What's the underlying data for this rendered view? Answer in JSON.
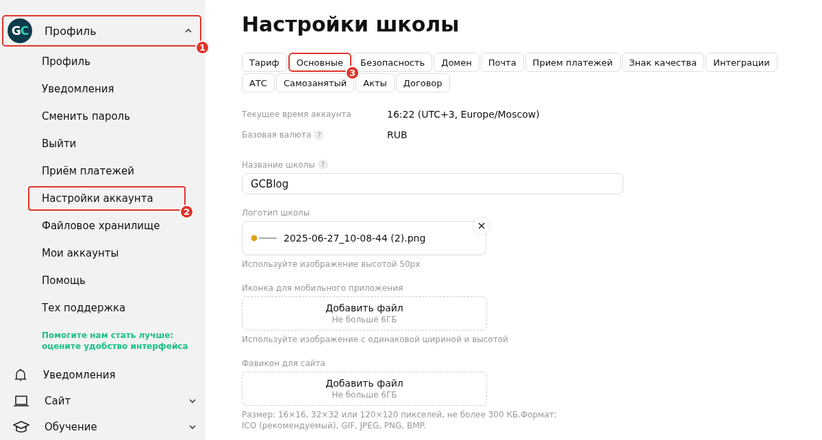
{
  "sidebar": {
    "header": {
      "logo": [
        "G",
        "C"
      ],
      "label": "Профиль",
      "expanded": true,
      "callout": "1"
    },
    "items": [
      {
        "label": "Профиль"
      },
      {
        "label": "Уведомления"
      },
      {
        "label": "Сменить пароль"
      },
      {
        "label": "Выйти"
      },
      {
        "label": "Приём платежей"
      },
      {
        "label": "Настройки аккаунта",
        "callout": "2"
      },
      {
        "label": "Файловое хранилище"
      },
      {
        "label": "Мои аккаунты"
      },
      {
        "label": "Помощь"
      },
      {
        "label": "Тех поддержка"
      }
    ],
    "feedback": "Помогите нам стать лучше: оцените удобство интерфейса",
    "sections": [
      {
        "kind": "bell",
        "label": "Уведомления"
      },
      {
        "kind": "laptop",
        "label": "Сайт",
        "expanded": false
      },
      {
        "kind": "cap",
        "label": "Обучение",
        "expanded": false
      }
    ]
  },
  "page": {
    "title": "Настройки школы",
    "tabs": [
      {
        "label": "Тариф"
      },
      {
        "label": "Основные",
        "callout": "3"
      },
      {
        "label": "Безопасность"
      },
      {
        "label": "Домен"
      },
      {
        "label": "Почта"
      },
      {
        "label": "Прием платежей"
      },
      {
        "label": "Знак качества"
      },
      {
        "label": "Интеграции"
      },
      {
        "label": "АТС"
      },
      {
        "label": "Самозанятый"
      },
      {
        "label": "Акты"
      },
      {
        "label": "Договор"
      }
    ],
    "info": [
      {
        "label": "Текущее время аккаунта",
        "value": "16:22 (UTC+3, Europe/Moscow)"
      },
      {
        "label": "Базовая валюта",
        "help": "?",
        "value": "RUB"
      }
    ],
    "school_name": {
      "label": "Название школы",
      "help": "?",
      "value": "GCBlog"
    },
    "logo": {
      "label": "Логотип школы",
      "file": "2025-06-27_10-08-44 (2).png",
      "hint": "Используйте изображение высотой 50px"
    },
    "uploads": [
      {
        "label": "Иконка для мобильного приложения",
        "button": "Добавить файл",
        "limit": "Не больше 6ГБ",
        "hint": "Используйте изображение с одинаковой шириной и высотой"
      },
      {
        "label": "Фавикон для сайта",
        "button": "Добавить файл",
        "limit": "Не больше 6ГБ",
        "hint": "Размер: 16×16, 32×32 или 120×120 пикселей, не более 300 КБ.Формат: ICO (рекомендуемый), GIF, JPEG, PNG, BMP."
      }
    ]
  }
}
